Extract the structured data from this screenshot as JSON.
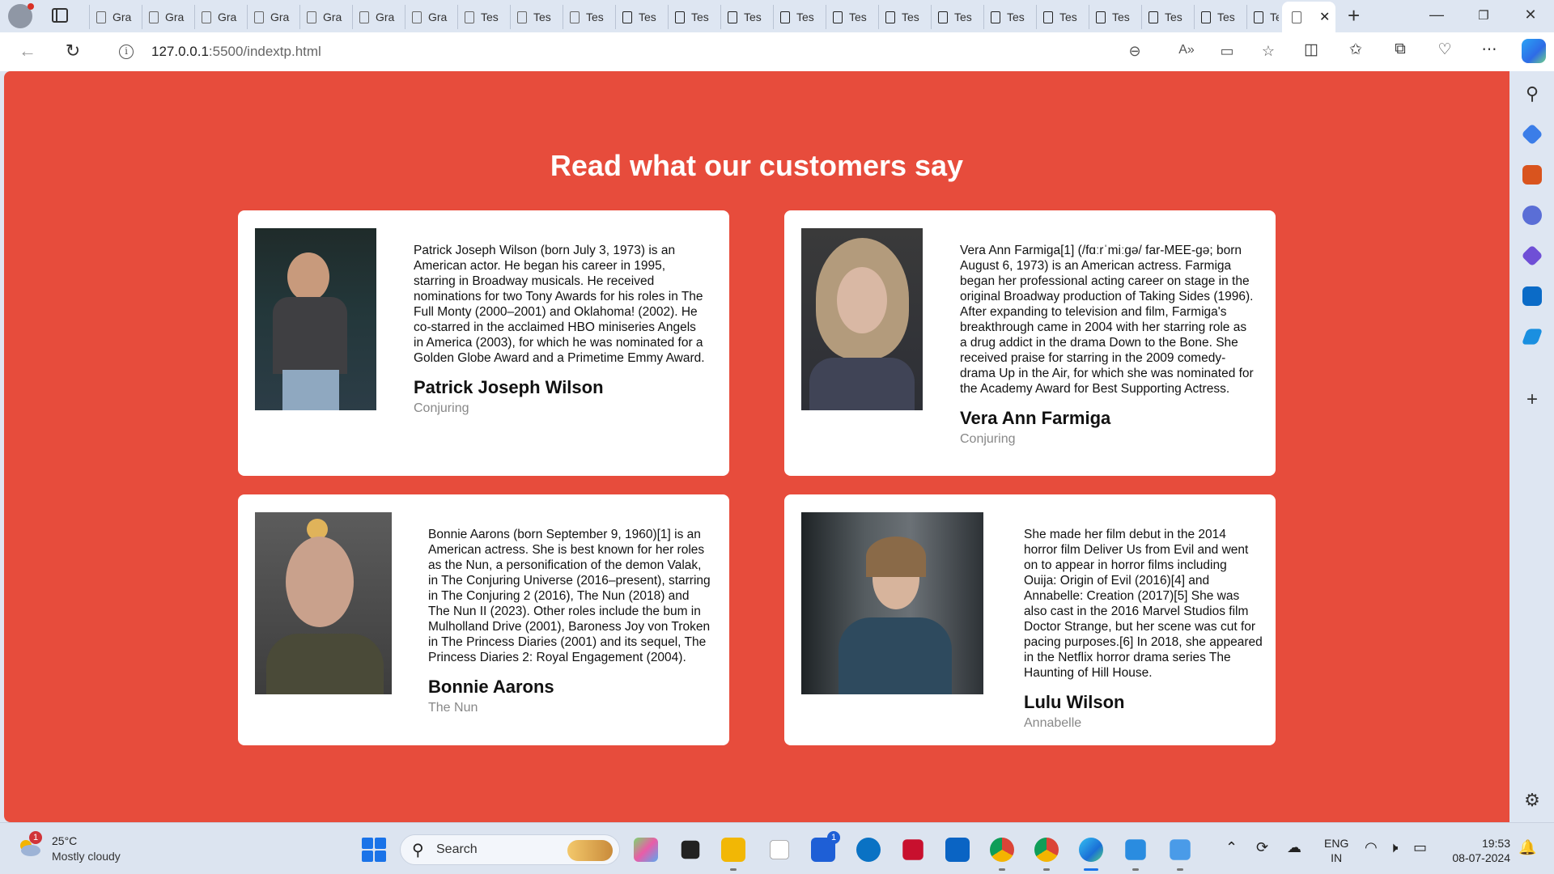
{
  "browser": {
    "tabs": [
      {
        "label": "Gra"
      },
      {
        "label": "Gra"
      },
      {
        "label": "Gra"
      },
      {
        "label": "Gra"
      },
      {
        "label": "Gra"
      },
      {
        "label": "Gra"
      },
      {
        "label": "Gra"
      },
      {
        "label": "Tes"
      },
      {
        "label": "Tes"
      },
      {
        "label": "Tes"
      },
      {
        "label": "Tes"
      },
      {
        "label": "Tes"
      },
      {
        "label": "Tes"
      },
      {
        "label": "Tes"
      },
      {
        "label": "Tes"
      },
      {
        "label": "Tes"
      },
      {
        "label": "Tes"
      },
      {
        "label": "Tes"
      },
      {
        "label": "Tes"
      },
      {
        "label": "Tes"
      },
      {
        "label": "Tes"
      },
      {
        "label": "Tes"
      },
      {
        "label": "Tes"
      }
    ],
    "url_host": "127.0.0.1",
    "url_path": ":5500/indextp.html",
    "accent": "#1a73e8"
  },
  "page": {
    "heading": "Read what our customers say",
    "background": "#e74c3c",
    "testimonials": [
      {
        "quote": "Patrick Joseph Wilson (born July 3, 1973) is an American actor. He began his career in 1995, starring in Broadway musicals. He received nominations for two Tony Awards for his roles in The Full Monty (2000–2001) and Oklahoma! (2002). He co-starred in the acclaimed HBO miniseries Angels in America (2003), for which he was nominated for a Golden Globe Award and a Primetime Emmy Award.",
        "name": "Patrick Joseph Wilson",
        "role": "Conjuring"
      },
      {
        "quote": "Vera Ann Farmiga[1] (/fɑːrˈmiːɡə/ far-MEE-gə; born August 6, 1973) is an American actress. Farmiga began her professional acting career on stage in the original Broadway production of Taking Sides (1996). After expanding to television and film, Farmiga's breakthrough came in 2004 with her starring role as a drug addict in the drama Down to the Bone. She received praise for starring in the 2009 comedy-drama Up in the Air, for which she was nominated for the Academy Award for Best Supporting Actress.",
        "name": "Vera Ann Farmiga",
        "role": "Conjuring"
      },
      {
        "quote": "Bonnie Aarons (born September 9, 1960)[1] is an American actress. She is best known for her roles as the Nun, a personification of the demon Valak, in The Conjuring Universe (2016–present), starring in The Conjuring 2 (2016), The Nun (2018) and The Nun II (2023). Other roles include the bum in Mulholland Drive (2001), Baroness Joy von Troken in The Princess Diaries (2001) and its sequel, The Princess Diaries 2: Royal Engagement (2004).",
        "name": "Bonnie Aarons",
        "role": "The Nun"
      },
      {
        "quote": "She made her film debut in the 2014 horror film Deliver Us from Evil and went on to appear in horror films including Ouija: Origin of Evil (2016)[4] and Annabelle: Creation (2017)[5] She was also cast in the 2016 Marvel Studios film Doctor Strange, but her scene was cut for pacing purposes.[6] In 2018, she appeared in the Netflix horror drama series The Haunting of Hill House.",
        "name": "Lulu Wilson",
        "role": "Annabelle"
      }
    ]
  },
  "taskbar": {
    "weather_temp": "25°C",
    "weather_cond": "Mostly cloudy",
    "weather_badge": "1",
    "search_label": "Search",
    "store_badge": "1",
    "lang_line1": "ENG",
    "lang_line2": "IN",
    "time": "19:53",
    "date": "08-07-2024"
  }
}
